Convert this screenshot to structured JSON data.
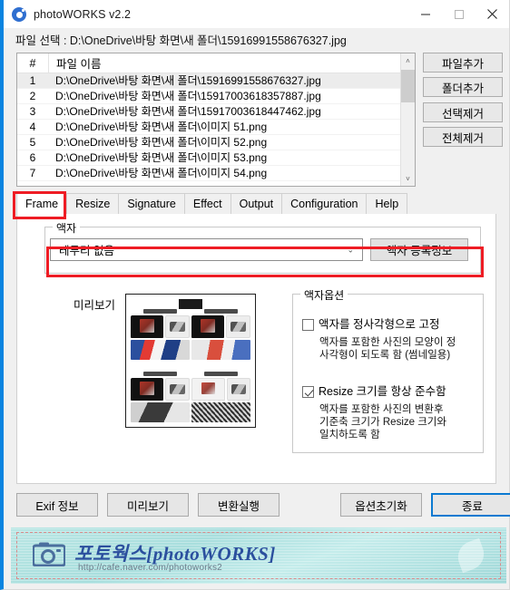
{
  "window": {
    "title": "photoWORKS v2.2",
    "icon": "camera-circle-icon",
    "minimize": "—",
    "maximize": "□",
    "close": "✕"
  },
  "path_row": {
    "text": "파일 선택 : D:\\OneDrive\\바탕 화면\\새 폴더\\15916991558676327.jpg"
  },
  "file_list": {
    "columns": [
      "#",
      "파일 이름"
    ],
    "rows": [
      {
        "num": "1",
        "name": "D:\\OneDrive\\바탕 화면\\새 폴더\\15916991558676327.jpg",
        "selected": true
      },
      {
        "num": "2",
        "name": "D:\\OneDrive\\바탕 화면\\새 폴더\\15917003618357887.jpg",
        "selected": false
      },
      {
        "num": "3",
        "name": "D:\\OneDrive\\바탕 화면\\새 폴더\\15917003618447462.jpg",
        "selected": false
      },
      {
        "num": "4",
        "name": "D:\\OneDrive\\바탕 화면\\새 폴더\\이미지 51.png",
        "selected": false
      },
      {
        "num": "5",
        "name": "D:\\OneDrive\\바탕 화면\\새 폴더\\이미지 52.png",
        "selected": false
      },
      {
        "num": "6",
        "name": "D:\\OneDrive\\바탕 화면\\새 폴더\\이미지 53.png",
        "selected": false
      },
      {
        "num": "7",
        "name": "D:\\OneDrive\\바탕 화면\\새 폴더\\이미지 54.png",
        "selected": false
      }
    ],
    "scroll_up": "˄",
    "scroll_down": "˅"
  },
  "side_buttons": [
    {
      "label": "파일추가"
    },
    {
      "label": "폴더추가"
    },
    {
      "label": "선택제거"
    },
    {
      "label": "전체제거"
    }
  ],
  "tabs": [
    {
      "label": "Frame",
      "active": true
    },
    {
      "label": "Resize",
      "active": false
    },
    {
      "label": "Signature",
      "active": false
    },
    {
      "label": "Effect",
      "active": false
    },
    {
      "label": "Output",
      "active": false
    },
    {
      "label": "Configuration",
      "active": false
    },
    {
      "label": "Help",
      "active": false
    }
  ],
  "frame_group": {
    "title": "액자",
    "combo_value": "테두리 없음",
    "combo_caret": "⌄",
    "info_button": "액자 등록정보"
  },
  "preview": {
    "label": "미리보기"
  },
  "option_group": {
    "title": "액자옵션",
    "options": [
      {
        "checked": false,
        "label": "액자를 정사각형으로 고정",
        "description": "액자를 포함한 사진의 모양이 정\n사각형이 되도록 함 (썸네일용)"
      },
      {
        "checked": true,
        "label": "Resize 크기를 항상 준수함",
        "description": "액자를 포함한 사진의 변환후\n기준축 크기가 Resize 크기와\n일치하도록 함"
      }
    ]
  },
  "bottom_buttons": {
    "exif": "Exif 정보",
    "preview": "미리보기",
    "convert": "변환실행",
    "reset": "옵션초기화",
    "exit": "종료"
  },
  "banner": {
    "title": "포토웍스[photoWORKS]",
    "url": "http://cafe.naver.com/photoworks2",
    "icon": "camera-icon"
  },
  "colors": {
    "accent": "#0a84e0",
    "annotation": "#ee1c24",
    "focus": "#0b7ad1",
    "banner_bg": "#a8dedd",
    "banner_text": "#2b4f9e"
  }
}
